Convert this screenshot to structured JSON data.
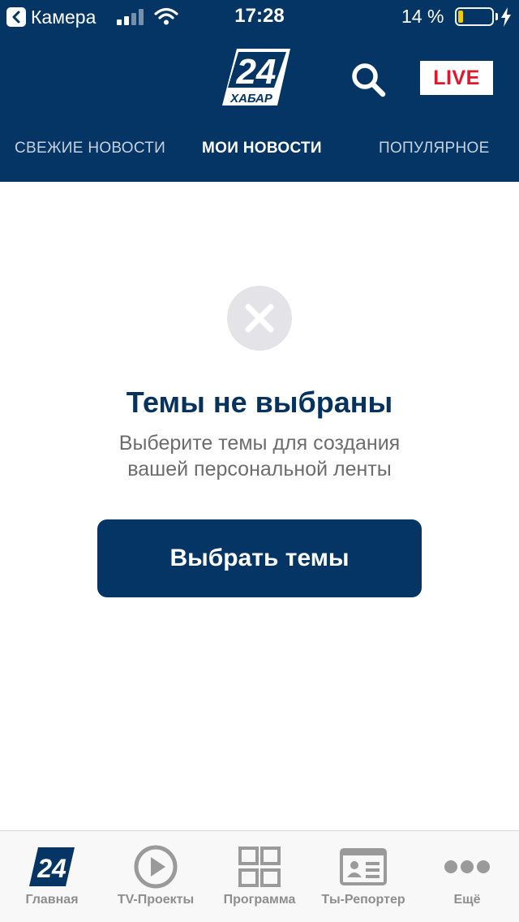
{
  "status_bar": {
    "back_app": "Камера",
    "time": "17:28",
    "battery_percent_text": "14 %",
    "battery_level": 0.14,
    "battery_color": "#ffd400"
  },
  "header": {
    "logo_number": "24",
    "logo_text": "ХАБАР",
    "search_icon": "search-icon",
    "live_label": "LIVE",
    "background_color": "#053565",
    "live_color": "#e0162b"
  },
  "tabs": [
    {
      "label": "СВЕЖИЕ НОВОСТИ",
      "active": false
    },
    {
      "label": "МОИ НОВОСТИ",
      "active": true
    },
    {
      "label": "ПОПУЛЯРНОЕ",
      "active": false
    }
  ],
  "empty_state": {
    "icon": "close-circle-icon",
    "title": "Темы не выбраны",
    "subtitle_lines": [
      "Выберите темы для создания",
      "вашей персональной ленты"
    ],
    "button_label": "Выбрать темы"
  },
  "tab_bar": {
    "items": [
      {
        "label": "Главная",
        "icon": "logo-24-icon",
        "active": true
      },
      {
        "label": "TV-Проекты",
        "icon": "play-circle-icon",
        "active": false
      },
      {
        "label": "Программа",
        "icon": "grid-icon",
        "active": false
      },
      {
        "label": "Ты-Репортер",
        "icon": "id-card-icon",
        "active": false
      },
      {
        "label": "Ещё",
        "icon": "more-dots-icon",
        "active": false
      }
    ]
  }
}
